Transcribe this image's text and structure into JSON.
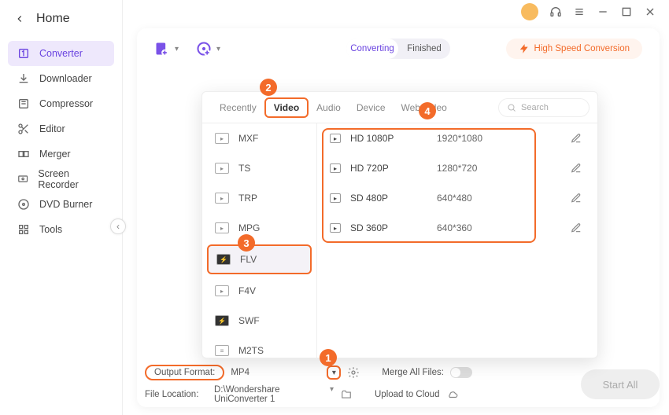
{
  "home": "Home",
  "sidebar": [
    {
      "label": "Converter"
    },
    {
      "label": "Downloader"
    },
    {
      "label": "Compressor"
    },
    {
      "label": "Editor"
    },
    {
      "label": "Merger"
    },
    {
      "label": "Screen Recorder"
    },
    {
      "label": "DVD Burner"
    },
    {
      "label": "Tools"
    }
  ],
  "segmented": {
    "converting": "Converting",
    "finished": "Finished"
  },
  "high_speed": "High Speed Conversion",
  "popup_tabs": [
    "Recently",
    "Video",
    "Audio",
    "Device",
    "Web Video"
  ],
  "popup_active_tab": "Video",
  "search_placeholder": "Search",
  "formats": [
    "MXF",
    "TS",
    "TRP",
    "MPG",
    "FLV",
    "F4V",
    "SWF",
    "M2TS"
  ],
  "format_selected": "FLV",
  "resolutions": [
    {
      "name": "HD 1080P",
      "dim": "1920*1080"
    },
    {
      "name": "HD 720P",
      "dim": "1280*720"
    },
    {
      "name": "SD 480P",
      "dim": "640*480"
    },
    {
      "name": "SD 360P",
      "dim": "640*360"
    }
  ],
  "footer": {
    "output_format_label": "Output Format:",
    "output_format_value": "MP4",
    "merge_label": "Merge All Files:",
    "file_location_label": "File Location:",
    "file_location_value": "D:\\Wondershare UniConverter 1",
    "upload_label": "Upload to Cloud"
  },
  "start_all": "Start All",
  "badges": [
    "1",
    "2",
    "3",
    "4"
  ]
}
